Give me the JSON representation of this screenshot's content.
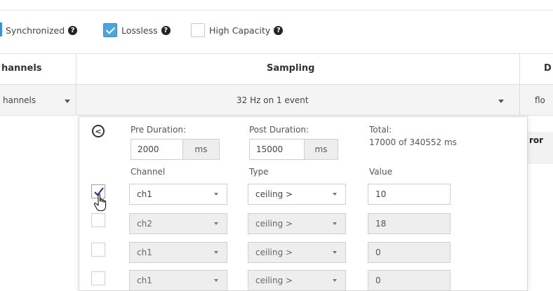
{
  "options": [
    {
      "label": "Synchronized",
      "checked": null
    },
    {
      "label": "Lossless",
      "checked": true
    },
    {
      "label": "High Capacity",
      "checked": false
    }
  ],
  "help_glyph": "?",
  "header": {
    "channels": "hannels",
    "sampling": "Sampling",
    "right": "D"
  },
  "row": {
    "channels_value": "hannels",
    "sampling_value": "32 Hz on 1 event",
    "right_value": "flo"
  },
  "error_partial": "ror",
  "popover": {
    "back_glyph": "<",
    "pre_duration": {
      "label": "Pre Duration:",
      "value": "2000",
      "unit": "ms"
    },
    "post_duration": {
      "label": "Post Duration:",
      "value": "15000",
      "unit": "ms"
    },
    "total": {
      "label": "Total:",
      "value": "17000 of 340552 ms"
    },
    "columns": {
      "channel": "Channel",
      "type": "Type",
      "value": "Value"
    },
    "rows": [
      {
        "checked": true,
        "channel": "ch1",
        "type": "ceiling >",
        "value": "10",
        "enabled": true
      },
      {
        "checked": false,
        "channel": "ch2",
        "type": "ceiling >",
        "value": "18",
        "enabled": false
      },
      {
        "checked": false,
        "channel": "ch1",
        "type": "ceiling >",
        "value": "0",
        "enabled": false
      },
      {
        "checked": false,
        "channel": "ch1",
        "type": "ceiling >",
        "value": "0",
        "enabled": false
      }
    ]
  },
  "colors": {
    "accent": "#4da3dc",
    "border": "#cfcfcf",
    "disabled": "#eeeeee"
  }
}
